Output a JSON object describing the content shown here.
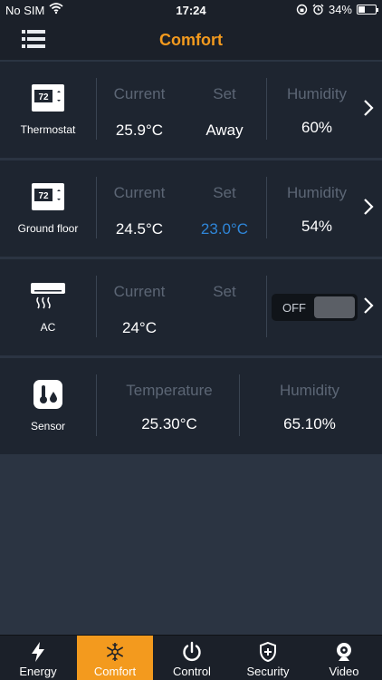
{
  "status_bar": {
    "carrier": "No SIM",
    "time": "17:24",
    "battery": "34%"
  },
  "header": {
    "title": "Comfort"
  },
  "devices": [
    {
      "name": "Thermostat",
      "icon_text": "72",
      "current_label": "Current",
      "set_label": "Set",
      "humidity_label": "Humidity",
      "current": "25.9°C",
      "set": "Away",
      "humidity": "60%"
    },
    {
      "name": "Ground floor",
      "icon_text": "72",
      "current_label": "Current",
      "set_label": "Set",
      "humidity_label": "Humidity",
      "current": "24.5°C",
      "set": "23.0°C",
      "humidity": "54%"
    },
    {
      "name": "AC",
      "current_label": "Current",
      "set_label": "Set",
      "current": "24°C",
      "toggle_label": "OFF"
    },
    {
      "name": "Sensor",
      "temperature_label": "Temperature",
      "humidity_label": "Humidity",
      "temperature": "25.30°C",
      "humidity": "65.10%"
    }
  ],
  "tabs": [
    {
      "label": "Energy",
      "icon": "bolt-icon"
    },
    {
      "label": "Comfort",
      "icon": "snow-sun-icon",
      "active": true
    },
    {
      "label": "Control",
      "icon": "power-icon"
    },
    {
      "label": "Security",
      "icon": "shield-icon"
    },
    {
      "label": "Video",
      "icon": "webcam-icon"
    }
  ],
  "colors": {
    "accent": "#f39a1e",
    "set_highlight": "#2f86d8",
    "card_bg": "#1e2530",
    "page_bg": "#2b3442"
  }
}
